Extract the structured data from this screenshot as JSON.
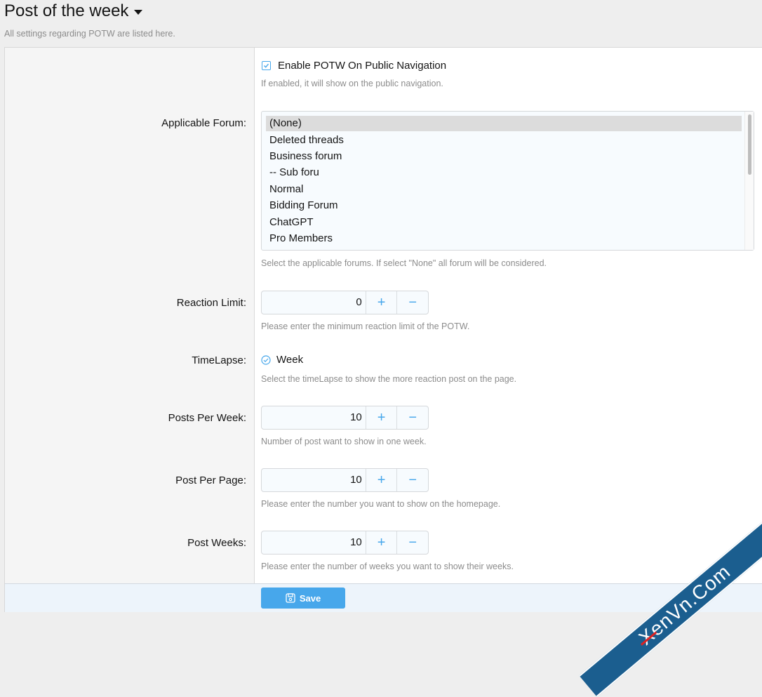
{
  "header": {
    "title": "Post of the week",
    "description": "All settings regarding POTW are listed here."
  },
  "settings": {
    "enable_potw": {
      "label": "Enable POTW On Public Navigation",
      "checked": true,
      "hint": "If enabled, it will show on the public navigation."
    },
    "applicable_forum": {
      "label": "Applicable Forum:",
      "options": [
        "(None)",
        "Deleted threads",
        "Business forum",
        "-- Sub foru",
        "Normal",
        "Bidding Forum",
        "ChatGPT",
        "Pro Members"
      ],
      "selected": "(None)",
      "hint": "Select the applicable forums. If select \"None\" all forum will be considered."
    },
    "reaction_limit": {
      "label": "Reaction Limit:",
      "value": "0",
      "hint": "Please enter the minimum reaction limit of the POTW."
    },
    "timelapse": {
      "label": "TimeLapse:",
      "value": "Week",
      "hint": "Select the timeLapse to show the more reaction post on the page."
    },
    "posts_per_week": {
      "label": "Posts Per Week:",
      "value": "10",
      "hint": "Number of post want to show in one week."
    },
    "post_per_page": {
      "label": "Post Per Page:",
      "value": "10",
      "hint": "Please enter the number you want to show on the homepage."
    },
    "post_weeks": {
      "label": "Post Weeks:",
      "value": "10",
      "hint": "Please enter the number of weeks you want to show their weeks."
    },
    "spin_plus": "+",
    "spin_minus": "−"
  },
  "footer": {
    "save_label": "Save"
  },
  "watermark": {
    "prefix": "X",
    "text": "enVn.Com"
  },
  "colors": {
    "accent": "#47a7eb",
    "watermark": "#1b5e8f"
  }
}
